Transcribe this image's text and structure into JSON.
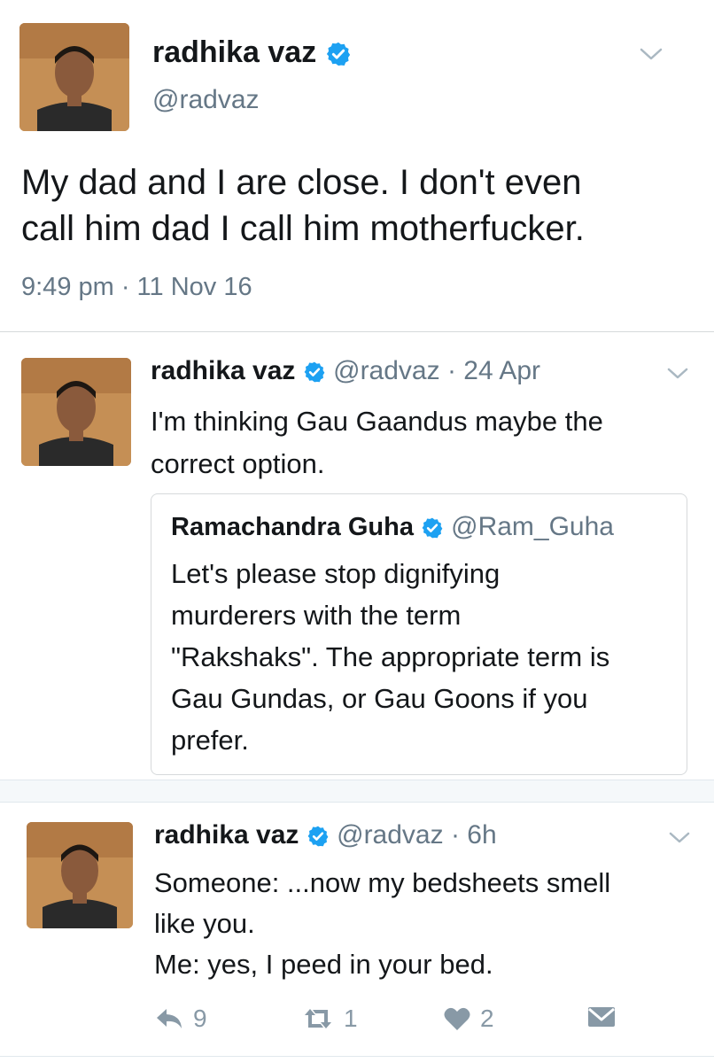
{
  "tweet_main": {
    "name": "radhika vaz",
    "handle": "@radvaz",
    "text_lines": [
      "My dad and I are close. I don't even",
      "call him dad I call him motherfucker."
    ],
    "timestamp": "9:49 pm · 11 Nov 16",
    "verified_icon": "verified-badge-icon",
    "menu_icon": "chevron-down-icon"
  },
  "tweet_reply": {
    "name": "radhika vaz",
    "handle": "@radvaz",
    "time": "· 24 Apr",
    "text_lines": [
      "I'm thinking Gau Gaandus maybe the",
      "correct option."
    ],
    "quote": {
      "name": "Ramachandra Guha",
      "handle": "@Ram_Guha",
      "text_lines": [
        "Let's please stop dignifying",
        "murderers with the term",
        "\"Rakshaks\". The appropriate term is",
        "Gau Gundas, or Gau Goons if you",
        "prefer."
      ]
    }
  },
  "tweet_third": {
    "name": "radhika vaz",
    "handle": "@radvaz",
    "time": "· 6h",
    "text_lines": [
      "Someone: ...now my bedsheets smell",
      "like you.",
      "Me: yes, I peed in your bed."
    ],
    "actions": {
      "reply_count": "9",
      "retweet_count": "1",
      "like_count": "2"
    }
  },
  "colors": {
    "text": "#14171a",
    "secondary": "#657786",
    "verified": "#1da1f2",
    "icon": "#8899a6",
    "divider": "#d6d9db"
  }
}
